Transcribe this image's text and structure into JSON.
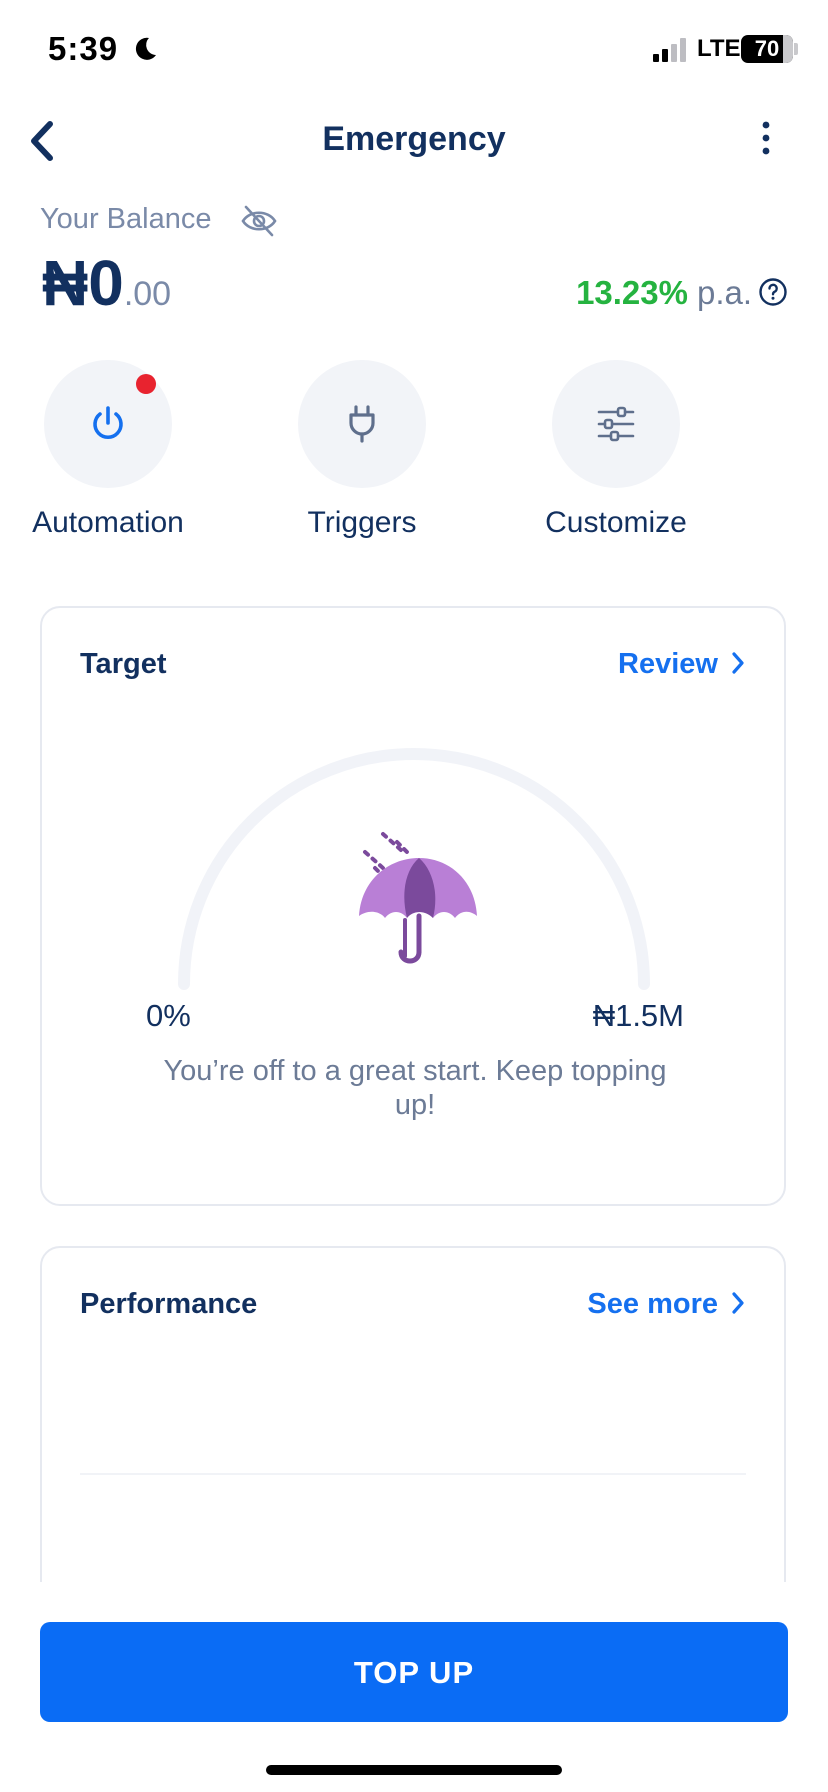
{
  "status_bar": {
    "time": "5:39",
    "network": "LTE",
    "battery": "70",
    "battery_level_percent": 70
  },
  "nav": {
    "title": "Emergency",
    "back_icon": "chevron-left-icon",
    "more_icon": "more-vertical-icon"
  },
  "balance": {
    "label": "Your Balance",
    "amount_main": "₦0",
    "amount_decimal": ".00",
    "rate": "13.23%",
    "rate_unit": "p.a.",
    "hide_icon": "eye-off-icon",
    "help_icon": "help-circle-icon"
  },
  "actions": [
    {
      "label": "Automation",
      "icon": "power-icon",
      "has_notification": true
    },
    {
      "label": "Triggers",
      "icon": "plug-icon",
      "has_notification": false
    },
    {
      "label": "Customize",
      "icon": "sliders-icon",
      "has_notification": false
    }
  ],
  "target": {
    "title": "Target",
    "link_label": "Review",
    "progress_percent": 0,
    "min_label": "0%",
    "max_label": "₦1.5M",
    "message": "You’re off to a great start. Keep topping up!",
    "icon": "umbrella-icon",
    "colors": {
      "track": "#f1f3f8",
      "umbrella": "#b97fd6",
      "umbrella_dark": "#7b4a9c"
    }
  },
  "performance": {
    "title": "Performance",
    "link_label": "See more"
  },
  "top_up": {
    "label": "TOP UP",
    "color": "#0a6cf5"
  },
  "colors": {
    "primary_text": "#12305f",
    "muted": "#6c7b96",
    "accent": "#1570ef",
    "positive": "#25b340",
    "notification": "#e8232f"
  }
}
